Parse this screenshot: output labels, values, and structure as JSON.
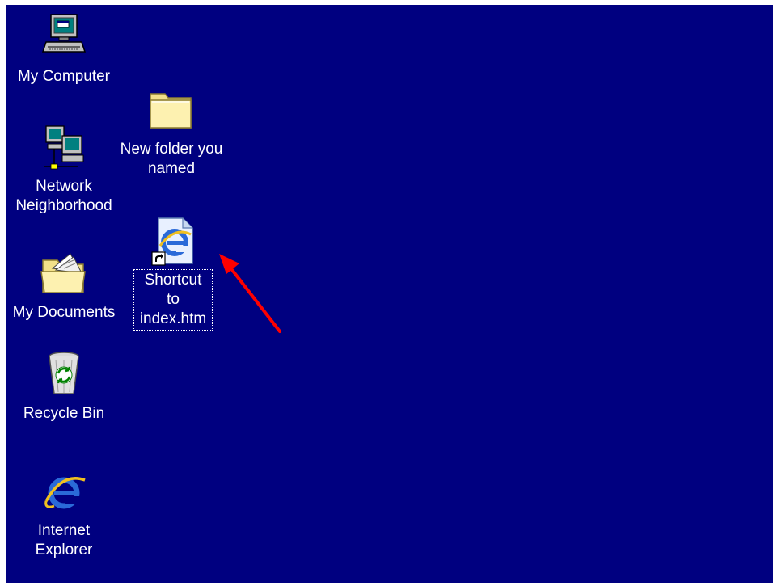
{
  "desktop": {
    "background_color": "#000080",
    "label_color": "#ffffff",
    "icons": [
      {
        "label": "My Computer",
        "icon": "my-computer-icon"
      },
      {
        "label": "New folder you\nnamed",
        "icon": "folder-icon"
      },
      {
        "label": "Network\nNeighborhood",
        "icon": "network-neighborhood-icon"
      },
      {
        "label": "Shortcut to\nindex.htm",
        "icon": "ie-shortcut-icon",
        "selected": true
      },
      {
        "label": "My Documents",
        "icon": "my-documents-icon"
      },
      {
        "label": "Recycle Bin",
        "icon": "recycle-bin-icon"
      },
      {
        "label": "Internet\nExplorer",
        "icon": "internet-explorer-icon"
      }
    ]
  },
  "annotation": {
    "arrow_color": "#ff0000",
    "icon": "red-arrow"
  }
}
